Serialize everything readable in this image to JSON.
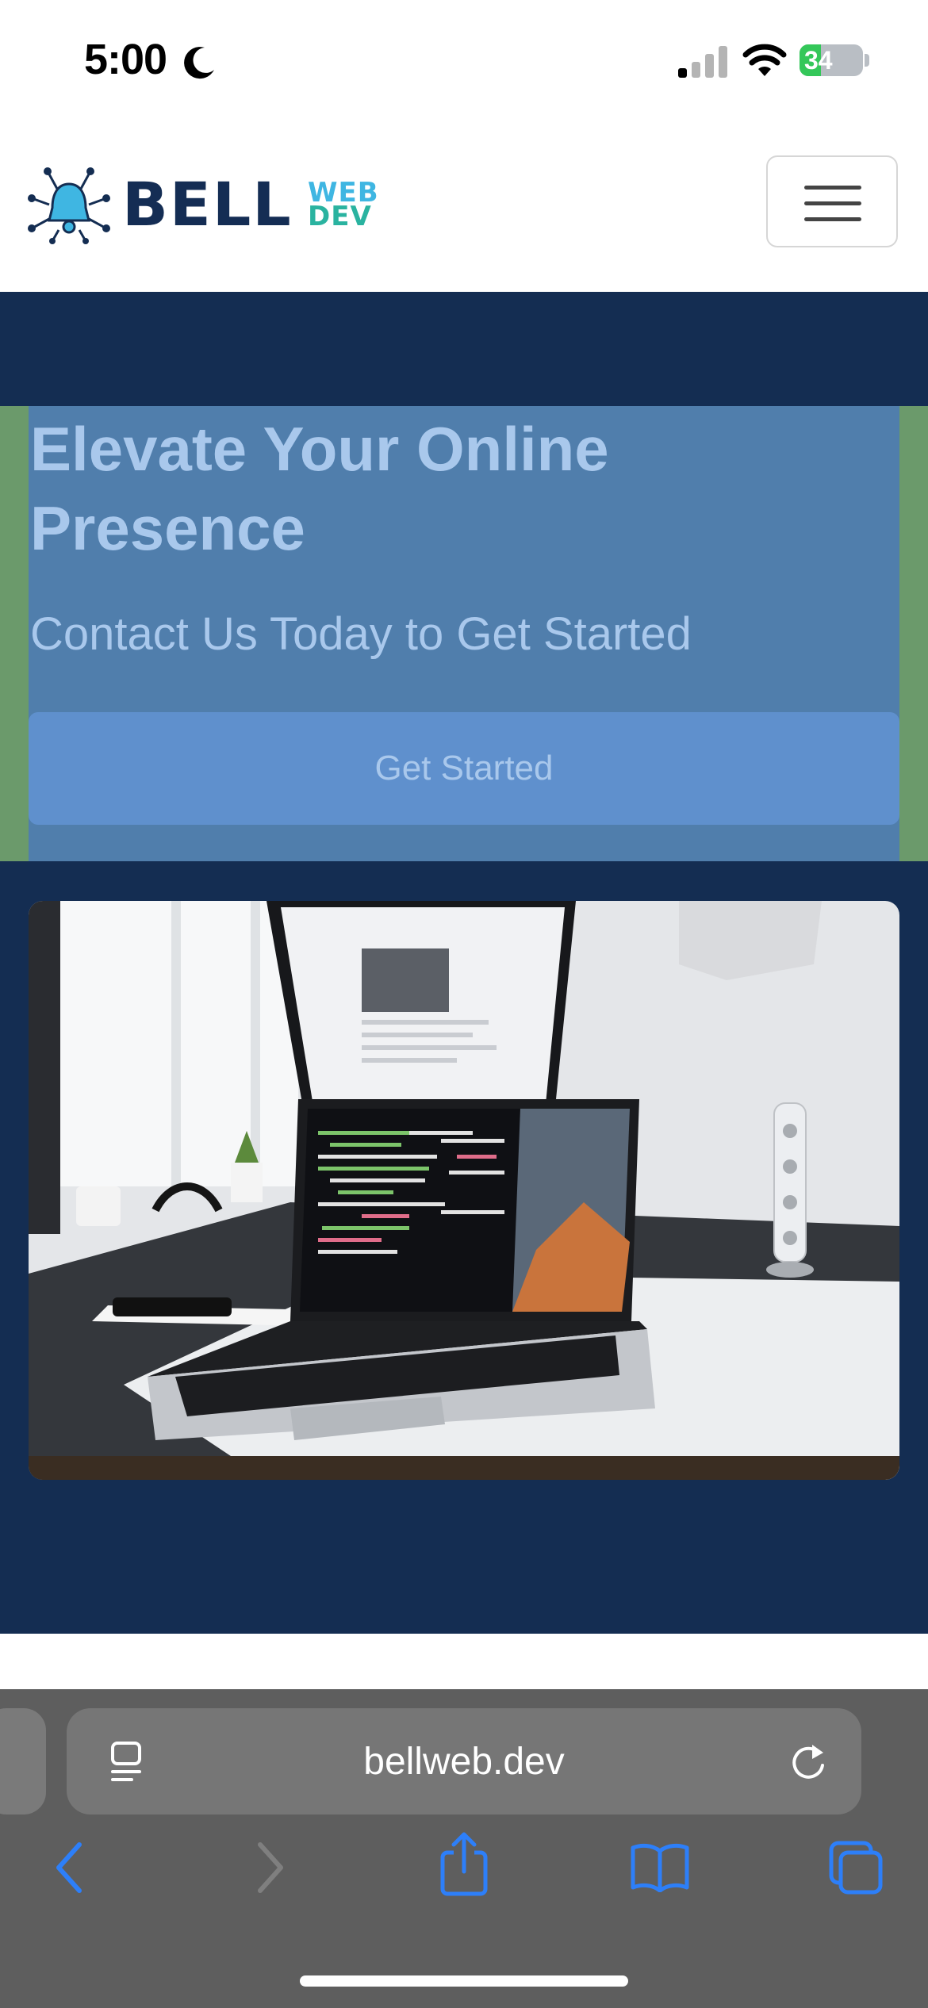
{
  "status_bar": {
    "time": "5:00",
    "battery": "34",
    "signal_bars_active": 1
  },
  "header": {
    "logo": {
      "main": "BELL",
      "top": "WEB",
      "bottom": "DEV"
    }
  },
  "hero": {
    "title": "Elevate Your Online Presence",
    "subtitle": "Contact Us Today to Get Started",
    "cta_label": "Get Started"
  },
  "browser": {
    "url": "bellweb.dev"
  },
  "icons": [
    "moon-icon",
    "signal-icon",
    "wifi-icon",
    "battery-icon",
    "menu-icon",
    "page-format-icon",
    "reload-icon",
    "back-icon",
    "forward-icon",
    "share-icon",
    "bookmarks-icon",
    "tabs-icon"
  ],
  "colors": {
    "navy": "#142d52",
    "hero_box": "#507eac",
    "hero_text": "#a9c8ec",
    "cta": "#5f90cd",
    "accent_blue": "#2d7ff9"
  }
}
